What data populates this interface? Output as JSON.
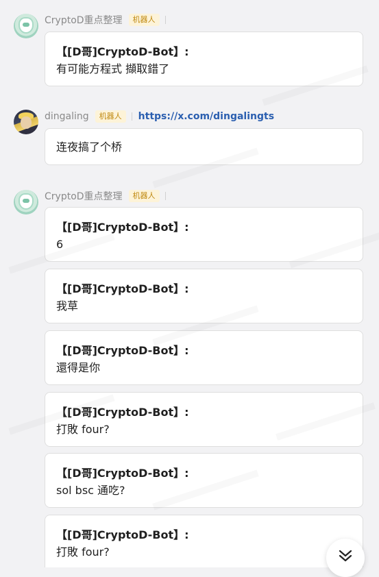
{
  "messages": [
    {
      "sender": "CryptoD重点整理",
      "badge": "机器人",
      "link": "",
      "avatar_icon": "crystal-avatar-icon",
      "bubbles": [
        {
          "title": "【[D哥]CryptoD-Bot】:",
          "text": "有可能方程式 擷取錯了"
        }
      ]
    },
    {
      "sender": "dingaling",
      "badge": "机器人",
      "link": "https://x.com/dingalingts",
      "avatar_icon": "anime-portrait-avatar-icon",
      "bubbles": [
        {
          "title": "",
          "text": "连夜搞了个桥"
        }
      ]
    },
    {
      "sender": "CryptoD重点整理",
      "badge": "机器人",
      "link": "",
      "avatar_icon": "crystal-avatar-icon",
      "bubbles": [
        {
          "title": "【[D哥]CryptoD-Bot】:",
          "text": "6"
        },
        {
          "title": "【[D哥]CryptoD-Bot】:",
          "text": "我草"
        },
        {
          "title": "【[D哥]CryptoD-Bot】:",
          "text": "還得是你"
        },
        {
          "title": "【[D哥]CryptoD-Bot】:",
          "text": "打敗 four?"
        },
        {
          "title": "【[D哥]CryptoD-Bot】:",
          "text": "sol bsc 通吃?"
        },
        {
          "title": "【[D哥]CryptoD-Bot】:",
          "text": "打敗 four?"
        }
      ]
    }
  ],
  "scroll_button_icon": "chevron-double-down-icon",
  "colors": {
    "background": "#f2f2f4",
    "bubble": "#ffffff",
    "badge_text": "#c08a12",
    "badge_bg": "#fdf3d8",
    "link": "#2b5fb0"
  }
}
